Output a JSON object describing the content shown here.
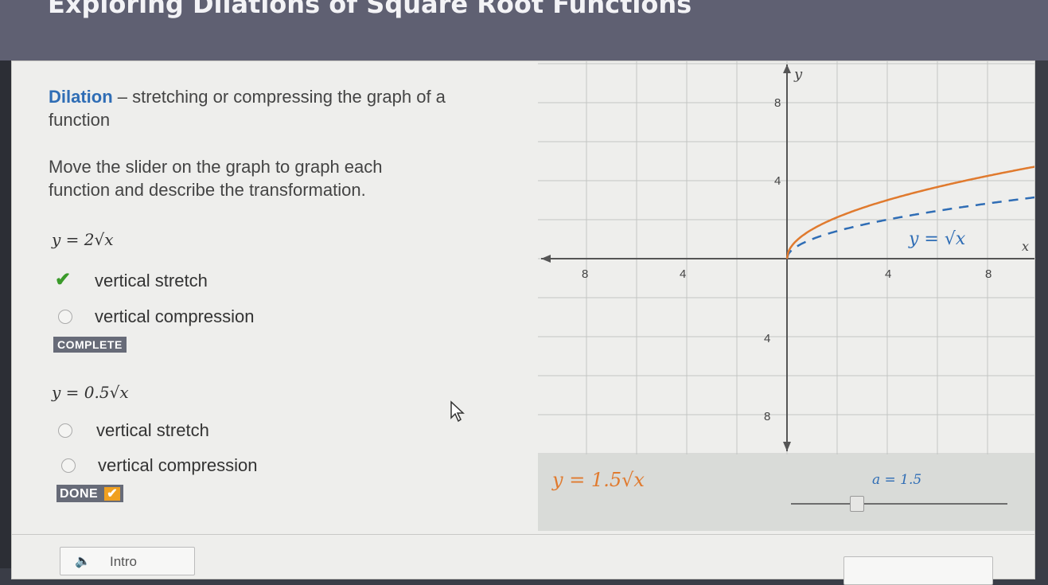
{
  "header": {
    "title": "Exploring Dilations of Square Root Functions"
  },
  "lesson": {
    "definition_term": "Dilation",
    "definition_text": " – stretching or compressing the graph of a function",
    "instruction": "Move the slider on the graph to graph each function and describe the transformation."
  },
  "questions": [
    {
      "equation": "y = 2√x",
      "options": [
        "vertical  stretch",
        "vertical compression"
      ],
      "selected": 0,
      "status": "COMPLETE"
    },
    {
      "equation": "y = 0.5√x",
      "options": [
        "vertical stretch",
        "vertical compression"
      ],
      "selected": null,
      "status": "DONE"
    }
  ],
  "graph": {
    "x_axis_label": "x",
    "y_axis_label": "y",
    "x_ticks": [
      "8",
      "4",
      "4",
      "8"
    ],
    "y_ticks": [
      "8",
      "4",
      "4",
      "8"
    ],
    "parent_label": "y = √x",
    "dilated_label": "y = 1.5√x",
    "slider_label": "a = 1.5",
    "slider_value": 1.5,
    "slider_min": 0,
    "slider_max": 5,
    "dilated_color": "#e07a2e",
    "parent_color": "#2f6db5"
  },
  "footer": {
    "intro_label": "Intro"
  }
}
